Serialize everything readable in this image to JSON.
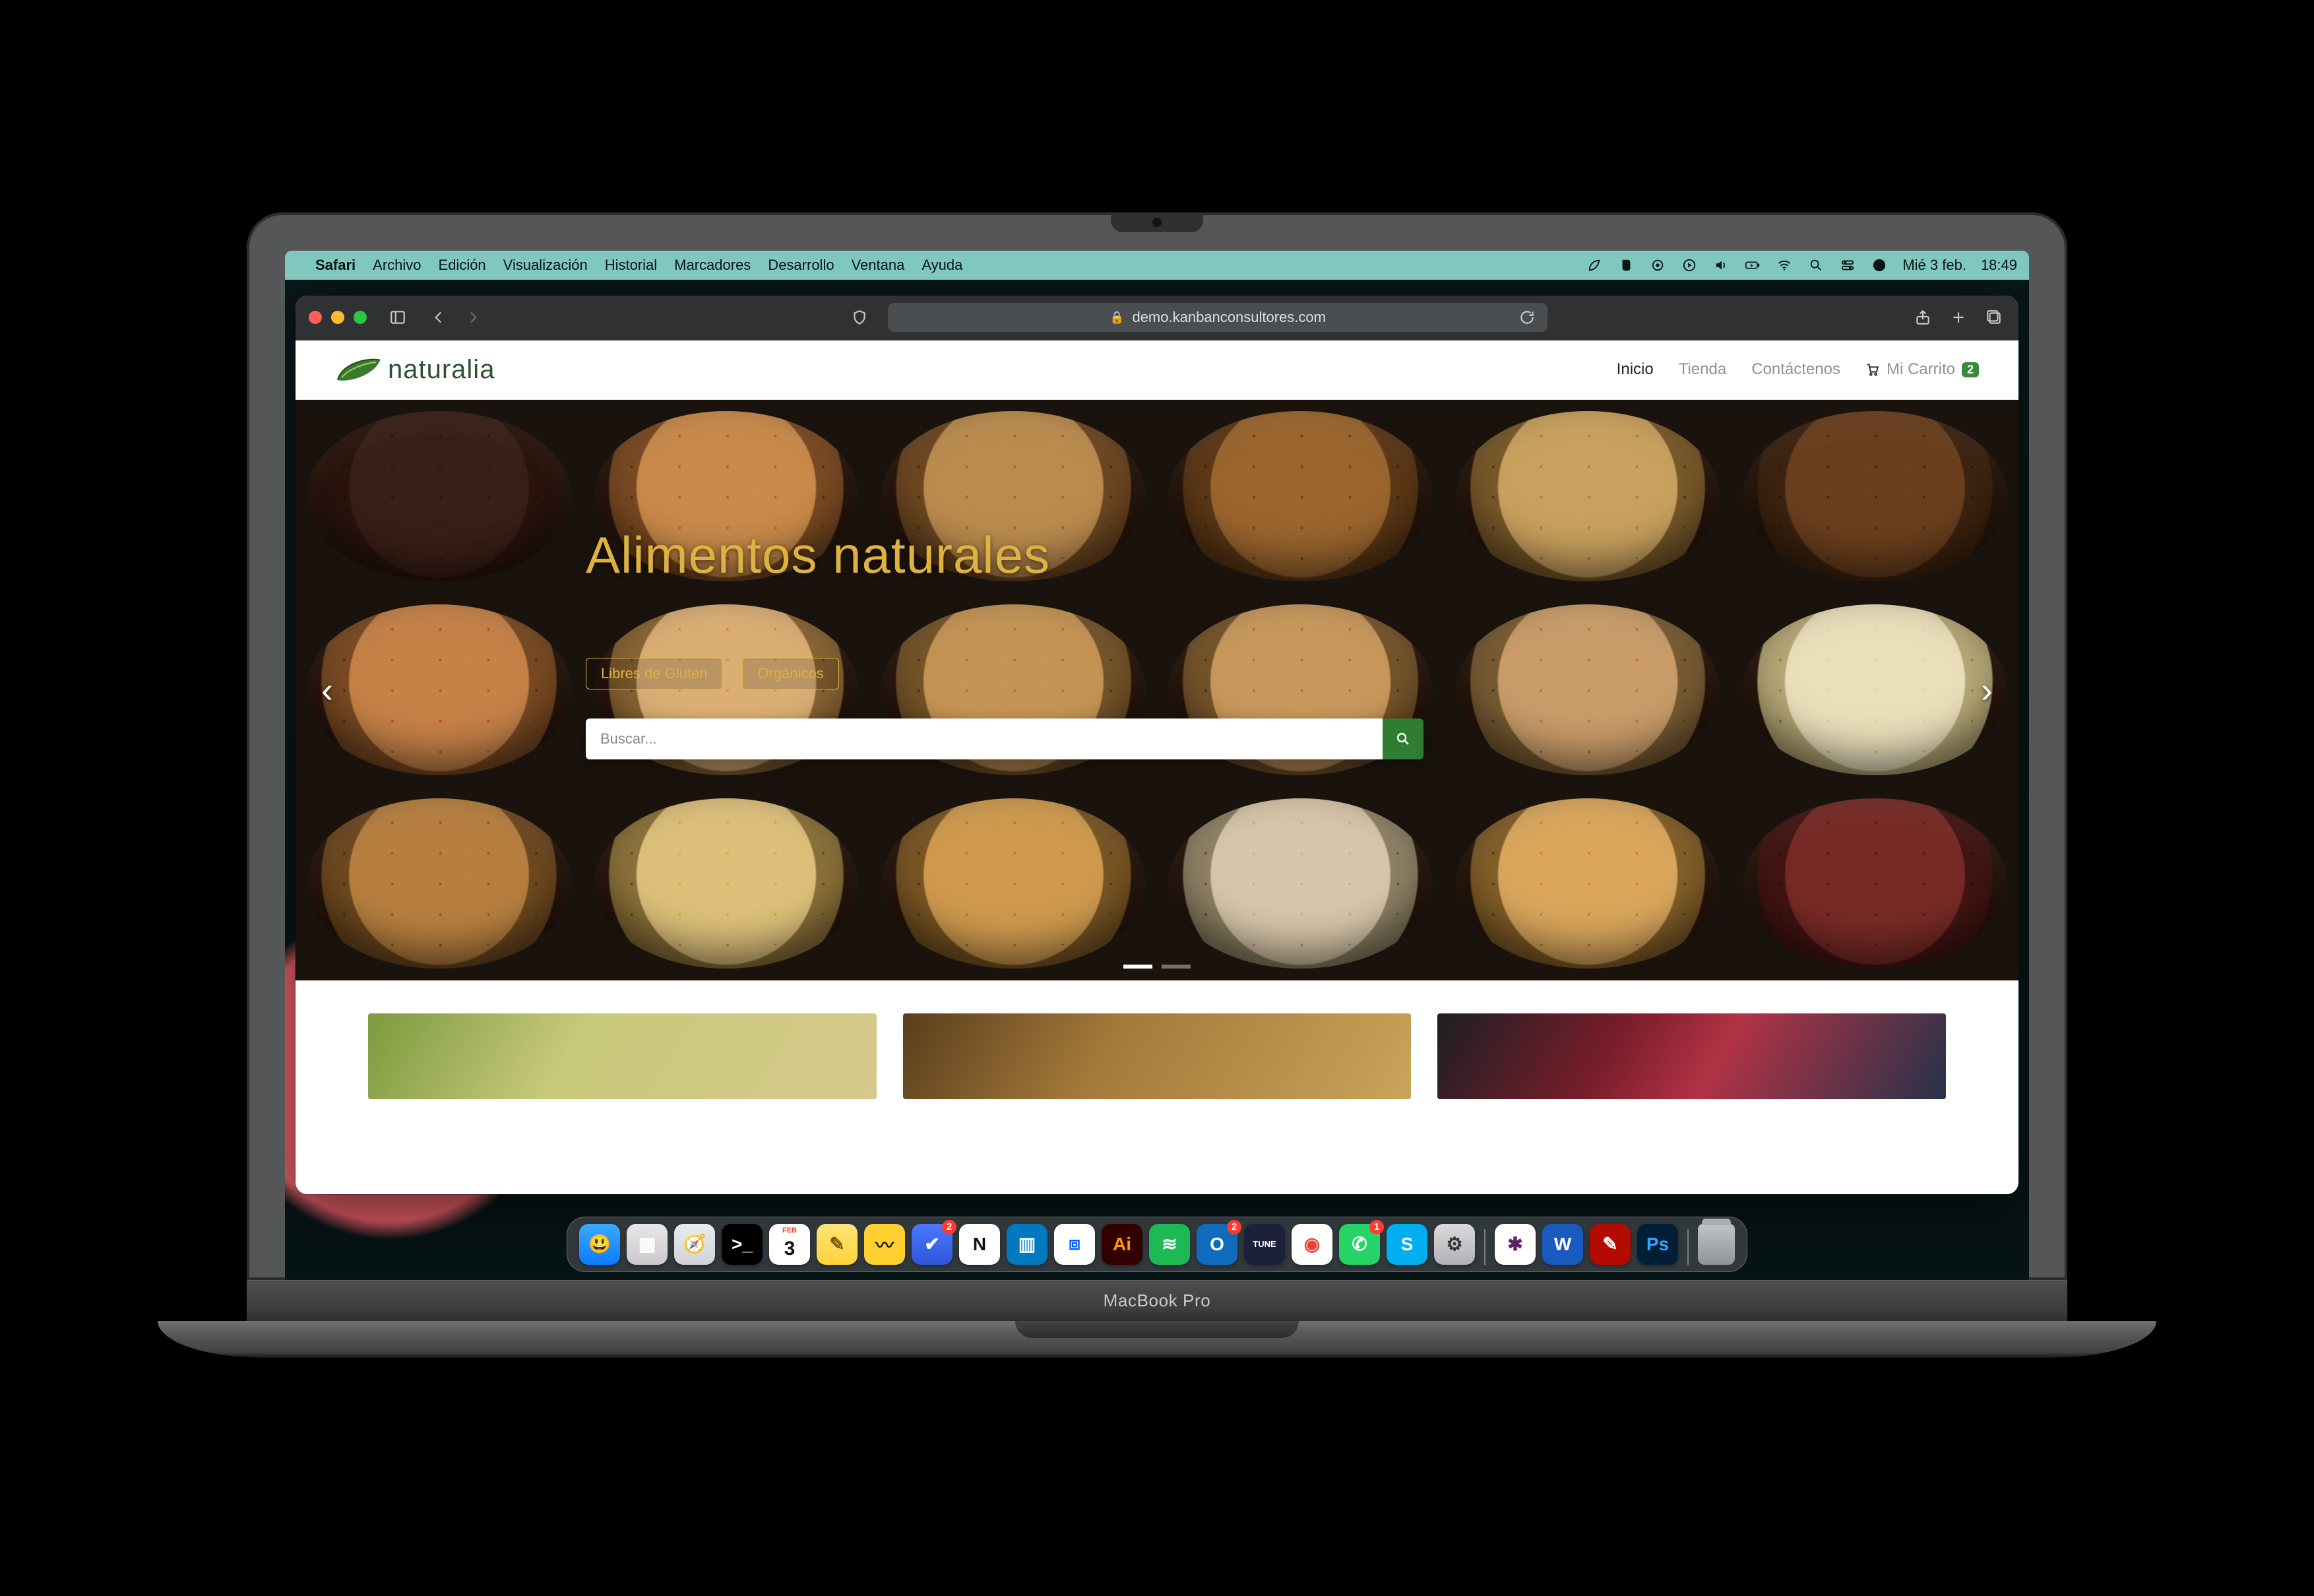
{
  "menubar": {
    "app": "Safari",
    "items": [
      "Archivo",
      "Edición",
      "Visualización",
      "Historial",
      "Marcadores",
      "Desarrollo",
      "Ventana",
      "Ayuda"
    ],
    "date": "Mié 3 feb.",
    "time": "18:49",
    "status_icons": [
      "leaf",
      "evernote",
      "record",
      "play",
      "volume",
      "battery",
      "wifi",
      "search",
      "control-center",
      "siri"
    ]
  },
  "safari": {
    "url_host": "demo.kanbanconsultores.com"
  },
  "site": {
    "brand": "naturalia",
    "nav": {
      "inicio": "Inicio",
      "tienda": "Tienda",
      "contactenos": "Contáctenos",
      "cart_label": "Mi Carrito",
      "cart_count": "2"
    },
    "hero": {
      "title": "Alimentos naturales",
      "tag_gluten": "Libres de Gluten",
      "tag_organic": "Orgánicos",
      "search_placeholder": "Buscar...",
      "slides_total": 2,
      "slide_active": 1
    },
    "bowls": [
      {
        "c1": "#3a1f17",
        "c2": "#2a140d"
      },
      {
        "c1": "#c98a4a",
        "c2": "#7b4a22"
      },
      {
        "c1": "#bb8b4e",
        "c2": "#6e4721"
      },
      {
        "c1": "#9b652e",
        "c2": "#5d3816"
      },
      {
        "c1": "#c9a15e",
        "c2": "#7a5929"
      },
      {
        "c1": "#6a3f1e",
        "c2": "#3e2310"
      },
      {
        "c1": "#c68147",
        "c2": "#7a4a22"
      },
      {
        "c1": "#dbae74",
        "c2": "#8a6433"
      },
      {
        "c1": "#c59454",
        "c2": "#755428"
      },
      {
        "c1": "#c8975b",
        "c2": "#76542a"
      },
      {
        "c1": "#c99c69",
        "c2": "#7a5c33"
      },
      {
        "c1": "#eadfba",
        "c2": "#b7a876"
      },
      {
        "c1": "#b77f3f",
        "c2": "#6f491f"
      },
      {
        "c1": "#dec07a",
        "c2": "#8d7239"
      },
      {
        "c1": "#cf9a4e",
        "c2": "#7a5624"
      },
      {
        "c1": "#d7c6a9",
        "c2": "#8f8265"
      },
      {
        "c1": "#d9a65c",
        "c2": "#845f28"
      },
      {
        "c1": "#772a25",
        "c2": "#431512"
      }
    ],
    "cards": [
      {
        "bg": "linear-gradient(120deg,#7c9a3e,#c8c97a 40%,#d6c98b)"
      },
      {
        "bg": "linear-gradient(120deg,#5a3d1c,#a47a3a 40%,#c9a459)"
      },
      {
        "bg": "linear-gradient(120deg,#1d1f24,#7a1d2a 35%,#b23245 55%,#26324a)"
      }
    ]
  },
  "dock": [
    {
      "name": "finder",
      "bg": "linear-gradient(#3aa9ff,#0a7cff)",
      "txt": "😃"
    },
    {
      "name": "launchpad",
      "bg": "linear-gradient(#e8e8ea,#c9c9cc)",
      "txt": "▦"
    },
    {
      "name": "safari",
      "bg": "linear-gradient(#e9ecef,#cfd3d7)",
      "txt": "🧭"
    },
    {
      "name": "terminal",
      "bg": "#000",
      "txt": ">_"
    },
    {
      "name": "calendar",
      "bg": "#fff",
      "txt": "3",
      "badge": "FEB",
      "color": "#111"
    },
    {
      "name": "notes",
      "bg": "linear-gradient(#ffe477,#ffd23a)",
      "txt": "✎",
      "color": "#7a5a00"
    },
    {
      "name": "miro",
      "bg": "#ffd02f",
      "txt": "〰",
      "color": "#222"
    },
    {
      "name": "todoist",
      "bg": "linear-gradient(#4a78ff,#2f57d8)",
      "txt": "✔",
      "badge_num": "2"
    },
    {
      "name": "notion",
      "bg": "#fff",
      "txt": "N",
      "color": "#111"
    },
    {
      "name": "trello",
      "bg": "#0079bf",
      "txt": "▥"
    },
    {
      "name": "dropbox",
      "bg": "#fff",
      "txt": "⧈",
      "color": "#0061ff"
    },
    {
      "name": "illustrator",
      "bg": "#330000",
      "txt": "Ai",
      "color": "#ff9a00"
    },
    {
      "name": "spotify",
      "bg": "#1db954",
      "txt": "≋"
    },
    {
      "name": "outlook",
      "bg": "#0f6cbd",
      "txt": "O",
      "badge_num": "2"
    },
    {
      "name": "tunein",
      "bg": "#1c203b",
      "txt": "TUNE",
      "fs": "13px"
    },
    {
      "name": "chrome",
      "bg": "#fff",
      "txt": "◉",
      "color": "#ea4335"
    },
    {
      "name": "whatsapp",
      "bg": "#25d366",
      "txt": "✆",
      "badge_num": "1"
    },
    {
      "name": "skype",
      "bg": "#00aff0",
      "txt": "S"
    },
    {
      "name": "settings",
      "bg": "linear-gradient(#d9dadd,#aeb1b5)",
      "txt": "⚙",
      "color": "#333"
    },
    {
      "name": "sep"
    },
    {
      "name": "slack",
      "bg": "#fff",
      "txt": "✱",
      "color": "#611f69"
    },
    {
      "name": "word",
      "bg": "#185abd",
      "txt": "W"
    },
    {
      "name": "acrobat",
      "bg": "#b30b00",
      "txt": "✎"
    },
    {
      "name": "photoshop",
      "bg": "#001e36",
      "txt": "Ps",
      "color": "#31a8ff"
    },
    {
      "name": "sep"
    },
    {
      "name": "trash",
      "bg": "",
      "txt": ""
    }
  ]
}
